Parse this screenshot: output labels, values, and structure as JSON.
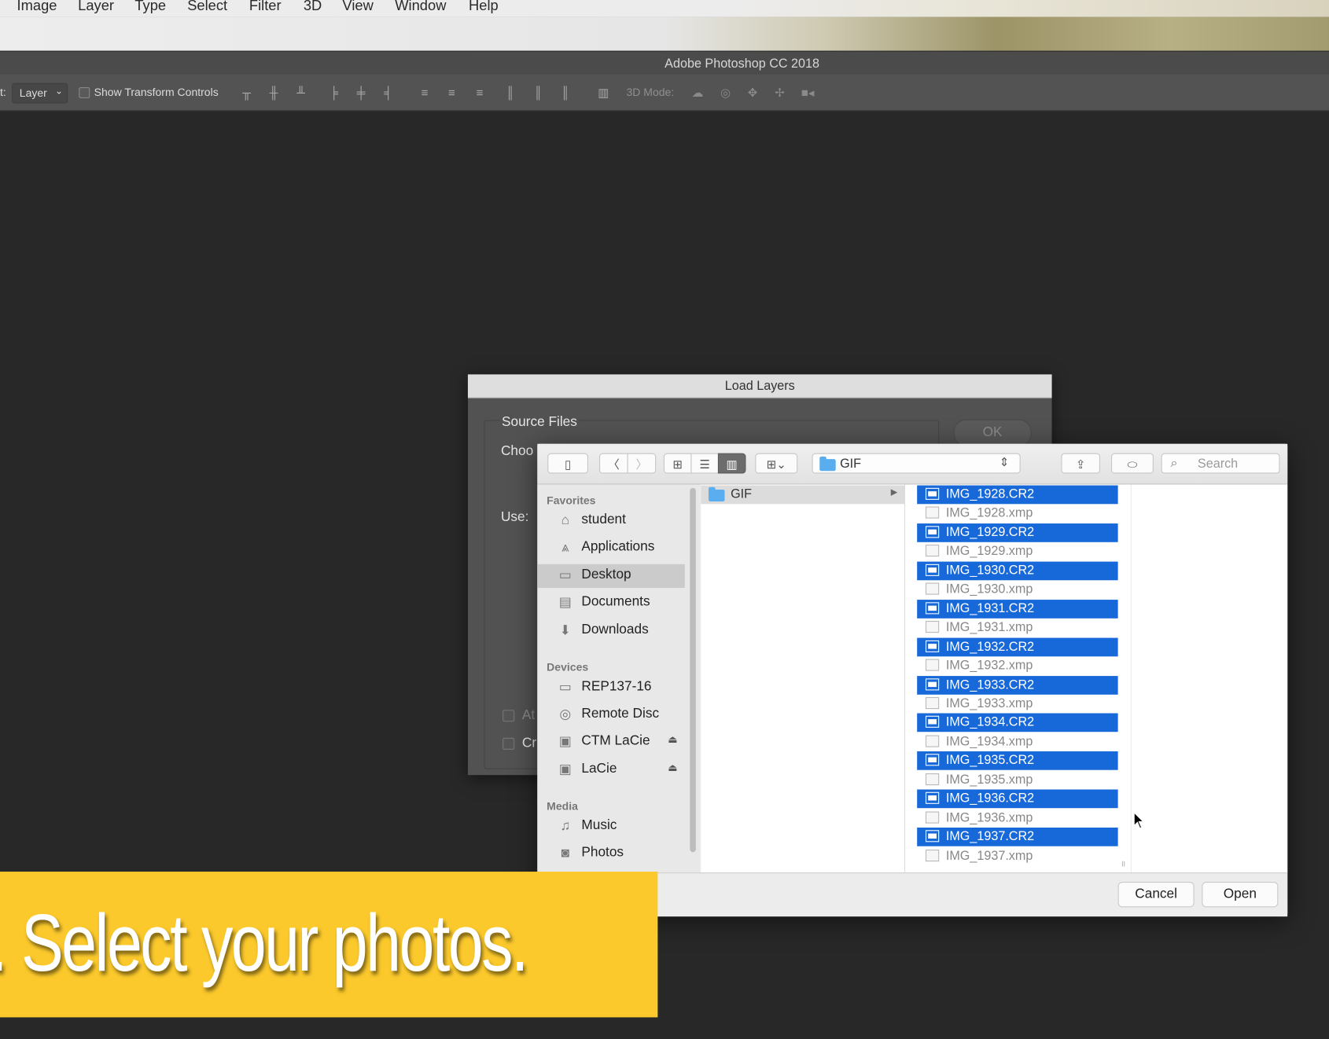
{
  "menubar": {
    "items": [
      "Image",
      "Layer",
      "Type",
      "Select",
      "Filter",
      "3D",
      "View",
      "Window",
      "Help"
    ]
  },
  "app": {
    "title": "Adobe Photoshop CC 2018"
  },
  "options_bar": {
    "tool_prefix": "t:",
    "auto_select_value": "Layer",
    "show_transform_controls": "Show Transform Controls",
    "show_transform_checked": false,
    "mode_3d_label": "3D Mode:"
  },
  "load_layers": {
    "title": "Load Layers",
    "source_files": "Source Files",
    "choose_label": "Choo",
    "use_label": "Use:",
    "ok": "OK",
    "checkbox1_label": "At",
    "checkbox2_label": "Cr"
  },
  "file_dialog": {
    "path": "GIF",
    "search_placeholder": "Search",
    "sidebar": {
      "favorites_header": "Favorites",
      "favorites": [
        {
          "label": "student",
          "icon": "home-icon"
        },
        {
          "label": "Applications",
          "icon": "applications-icon"
        },
        {
          "label": "Desktop",
          "icon": "desktop-icon",
          "selected": true
        },
        {
          "label": "Documents",
          "icon": "documents-icon"
        },
        {
          "label": "Downloads",
          "icon": "downloads-icon"
        }
      ],
      "devices_header": "Devices",
      "devices": [
        {
          "label": "REP137-16",
          "icon": "computer-icon"
        },
        {
          "label": "Remote Disc",
          "icon": "disc-icon"
        },
        {
          "label": "CTM LaCie",
          "icon": "drive-icon",
          "ejectable": true
        },
        {
          "label": "LaCie",
          "icon": "drive-icon",
          "ejectable": true
        }
      ],
      "media_header": "Media",
      "media": [
        {
          "label": "Music",
          "icon": "music-icon"
        },
        {
          "label": "Photos",
          "icon": "camera-icon"
        }
      ]
    },
    "column1": [
      {
        "name": "GIF",
        "type": "folder"
      }
    ],
    "files": [
      {
        "name": "IMG_1928.CR2",
        "selected": true
      },
      {
        "name": "IMG_1928.xmp",
        "selected": false
      },
      {
        "name": "IMG_1929.CR2",
        "selected": true
      },
      {
        "name": "IMG_1929.xmp",
        "selected": false
      },
      {
        "name": "IMG_1930.CR2",
        "selected": true
      },
      {
        "name": "IMG_1930.xmp",
        "selected": false
      },
      {
        "name": "IMG_1931.CR2",
        "selected": true
      },
      {
        "name": "IMG_1931.xmp",
        "selected": false
      },
      {
        "name": "IMG_1932.CR2",
        "selected": true
      },
      {
        "name": "IMG_1932.xmp",
        "selected": false
      },
      {
        "name": "IMG_1933.CR2",
        "selected": true
      },
      {
        "name": "IMG_1933.xmp",
        "selected": false
      },
      {
        "name": "IMG_1934.CR2",
        "selected": true
      },
      {
        "name": "IMG_1934.xmp",
        "selected": false
      },
      {
        "name": "IMG_1935.CR2",
        "selected": true
      },
      {
        "name": "IMG_1935.xmp",
        "selected": false
      },
      {
        "name": "IMG_1936.CR2",
        "selected": true
      },
      {
        "name": "IMG_1936.xmp",
        "selected": false
      },
      {
        "name": "IMG_1937.CR2",
        "selected": true
      },
      {
        "name": "IMG_1937.xmp",
        "selected": false
      }
    ],
    "cancel": "Cancel",
    "open": "Open"
  },
  "caption": ". Select your photos.",
  "colors": {
    "selection_blue": "#1768d8",
    "banner_yellow": "#fbc92c",
    "app_background": "#282828"
  }
}
